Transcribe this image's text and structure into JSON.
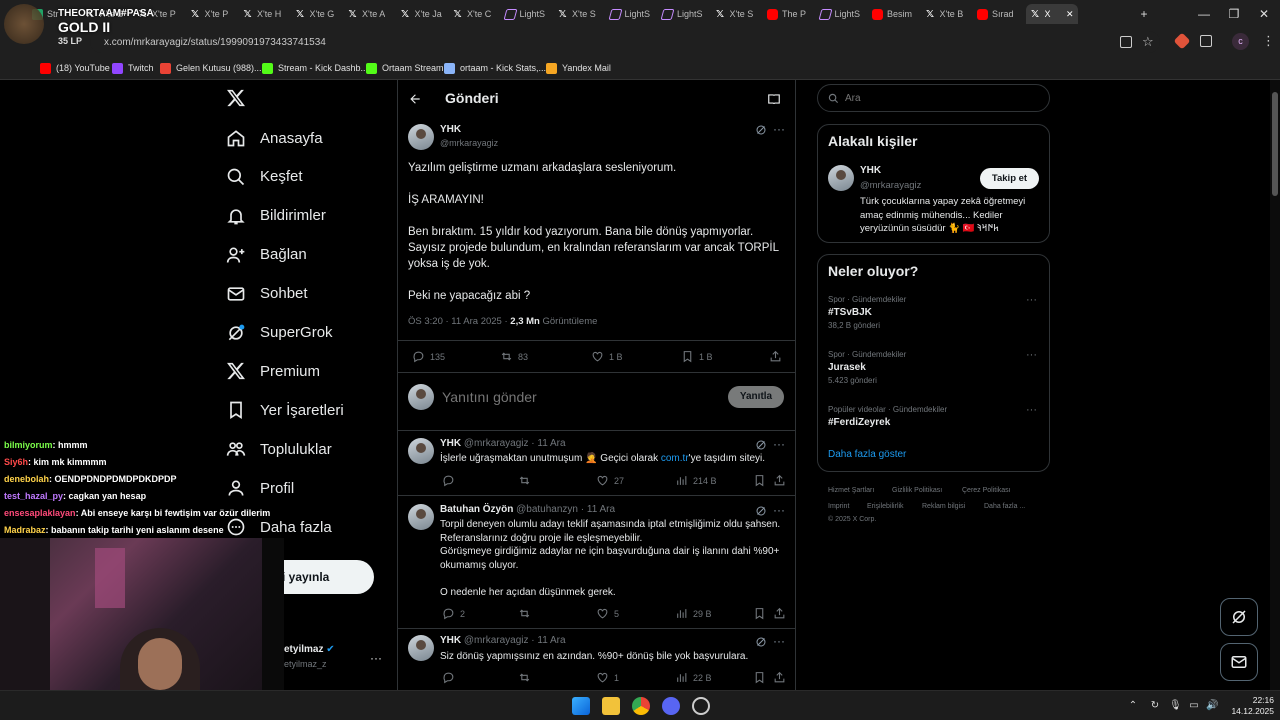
{
  "browser": {
    "tabs": [
      {
        "label": "Str",
        "icon": "spreadsheet"
      },
      {
        "label": "X'te B",
        "icon": "x"
      },
      {
        "label": "X'te P",
        "icon": "x"
      },
      {
        "label": "X'te P",
        "icon": "x"
      },
      {
        "label": "X'te H",
        "icon": "x"
      },
      {
        "label": "X'te G",
        "icon": "x"
      },
      {
        "label": "X'te A",
        "icon": "x"
      },
      {
        "label": "X'te Ja",
        "icon": "x"
      },
      {
        "label": "X'te C",
        "icon": "x"
      },
      {
        "label": "LightS",
        "icon": "lightshot"
      },
      {
        "label": "X'te S",
        "icon": "x"
      },
      {
        "label": "LightS",
        "icon": "lightshot"
      },
      {
        "label": "LightS",
        "icon": "lightshot"
      },
      {
        "label": "X'te S",
        "icon": "x"
      },
      {
        "label": "The P",
        "icon": "youtube"
      },
      {
        "label": "LightS",
        "icon": "lightshot"
      },
      {
        "label": "Besim",
        "icon": "youtube"
      },
      {
        "label": "X'te B",
        "icon": "x"
      },
      {
        "label": "Sırad",
        "icon": "youtube"
      },
      {
        "label": "X",
        "icon": "x",
        "active": true
      }
    ],
    "url": "x.com/mrkarayagiz/status/1999091973433741534",
    "bookmarks": [
      {
        "label": "(18) YouTube",
        "color": "#ff0000"
      },
      {
        "label": "Twitch",
        "color": "#9146ff"
      },
      {
        "label": "Gelen Kutusu (988)...",
        "color": "#ea4335"
      },
      {
        "label": "Stream - Kick Dashb...",
        "color": "#53fc18"
      },
      {
        "label": "Ortaam Stream",
        "color": "#53fc18"
      },
      {
        "label": "ortaam - Kick Stats,...",
        "color": "#8ab4f8"
      },
      {
        "label": "Yandex Mail",
        "color": "#f5a623"
      }
    ]
  },
  "overlay": {
    "streamer": "THEORTAAM#PASA",
    "rank": "GOLD II",
    "lp": "35 LP",
    "chat": [
      {
        "user": "bilmiyorum",
        "msg": ": hmmm",
        "color": "#7cff4a"
      },
      {
        "user": "Siy6h",
        "msg": ": kim mk kimmmm",
        "color": "#ff4a4a"
      },
      {
        "user": "denebolah",
        "msg": ": OENDPDNDPDMDPDKDPDP",
        "color": "#ffd34a"
      },
      {
        "user": "test_hazal_py",
        "msg": ": cagkan yan hesap",
        "color": "#c07aff"
      },
      {
        "user": "ensesaplaklayan",
        "msg": ": Abi enseye karşı bi fewtişim var özür dilerim",
        "color": "#ff4a7a"
      },
      {
        "user": "Madrabaz",
        "msg": ": babanın takip tarihi yeni aslanım desene",
        "color": "#ffd34a"
      }
    ]
  },
  "sidebar": {
    "items": [
      {
        "label": "Anasayfa",
        "icon": "home-icon"
      },
      {
        "label": "Keşfet",
        "icon": "search-icon"
      },
      {
        "label": "Bildirimler",
        "icon": "bell-icon"
      },
      {
        "label": "Bağlan",
        "icon": "add-person-icon"
      },
      {
        "label": "Sohbet",
        "icon": "mail-icon"
      },
      {
        "label": "SuperGrok",
        "icon": "grok-icon"
      },
      {
        "label": "Premium",
        "icon": "x-icon"
      },
      {
        "label": "Yer İşaretleri",
        "icon": "bookmark-icon"
      },
      {
        "label": "Topluluklar",
        "icon": "communities-icon"
      },
      {
        "label": "Profil",
        "icon": "profile-icon"
      },
      {
        "label": "Daha fazla",
        "icon": "more-circle-icon"
      }
    ],
    "post_button": "eri yayınla",
    "account_name": "etyilmaz",
    "account_handle": "etyilmaz_z"
  },
  "header": {
    "title": "Gönderi"
  },
  "post": {
    "name": "YHK",
    "handle": "@mrkarayagiz",
    "paragraphs": [
      "Yazılım geliştirme uzmanı arkadaşlara sesleniyorum.",
      "İŞ ARAMAYIN!",
      "Ben bıraktım. 15 yıldır kod yazıyorum. Bana bile dönüş yapmıyorlar. Sayısız projede bulundum, en kralından referanslarım var ancak TORPİL yoksa iş de yok.",
      "Peki ne yapacağız abi ?"
    ],
    "timestamp": "ÖS 3:20 · 11 Ara 2025 · ",
    "views": "2,3 Mn",
    "views_label": " Görüntüleme",
    "replies": "135",
    "reposts": "83",
    "likes": "1 B",
    "bookmarks": "1 B"
  },
  "reply_box": {
    "placeholder": "Yanıtını gönder",
    "button": "Yanıtla"
  },
  "replies": [
    {
      "name": "YHK",
      "handle": "@mrkarayagiz · 11 Ara",
      "text_pre": "İşlerle uğraşmaktan unutmuşum 🤦 Geçici olarak ",
      "link": "com.tr",
      "text_post": "'ye taşıdım siteyi.",
      "replies": "",
      "reposts": "",
      "likes": "27",
      "views": "214 B"
    },
    {
      "name": "Batuhan Özyön",
      "handle": "@batuhanzyn · 11 Ara",
      "text": "Torpil deneyen olumlu adayı teklif aşamasında iptal etmişliğimiz oldu şahsen. Referanslarınız doğru proje ile eşleşmeyebilir.\nGörüşmeye girdiğimiz adaylar ne için başvurduğuna dair iş ilanını dahi %90+ okumamış oluyor.\n\nO nedenle her açıdan düşünmek gerek.",
      "replies": "2",
      "reposts": "",
      "likes": "5",
      "views": "29 B"
    },
    {
      "name": "YHK",
      "handle": "@mrkarayagiz · 11 Ara",
      "text": "Siz dönüş yapmışsınız en azından. %90+ dönüş bile yok başvurulara.",
      "replies": "",
      "reposts": "",
      "likes": "1",
      "views": "22 B"
    }
  ],
  "search": {
    "placeholder": "Ara"
  },
  "related": {
    "title": "Alakalı kişiler",
    "name": "YHK",
    "handle": "@mrkarayagiz",
    "follow": "Takip et",
    "bio": "Türk çocuklarına yapay zekâ öğretmeyi amaç edinmiş mühendis... Kediler yeryüzünün süsüdür 🐈 🇹🇷 𐱅𐰇𐰺𐰚"
  },
  "trends": {
    "title": "Neler oluyor?",
    "items": [
      {
        "context": "Spor · Gündemdekiler",
        "name": "#TSvBJK",
        "count": "38,2 B gönderi"
      },
      {
        "context": "Spor · Gündemdekiler",
        "name": "Jurasek",
        "count": "5.423 gönderi"
      },
      {
        "context": "Popüler videolar · Gündemdekiler",
        "name": "#FerdiZeyrek",
        "count": ""
      }
    ],
    "more": "Daha fazla göster"
  },
  "footer": {
    "links": [
      "Hizmet Şartları",
      "Gizlilik Politikası",
      "Çerez Politikası",
      "Imprint",
      "Erişilebilirlik",
      "Reklam bilgisi",
      "Daha fazla ..."
    ],
    "copyright": "© 2025 X Corp."
  },
  "taskbar": {
    "time": "22:16",
    "date": "14.12.2025"
  },
  "colors": {
    "accent": "#1d9bf0",
    "background": "#000000",
    "border": "#2f3336",
    "muted": "#71767b"
  }
}
